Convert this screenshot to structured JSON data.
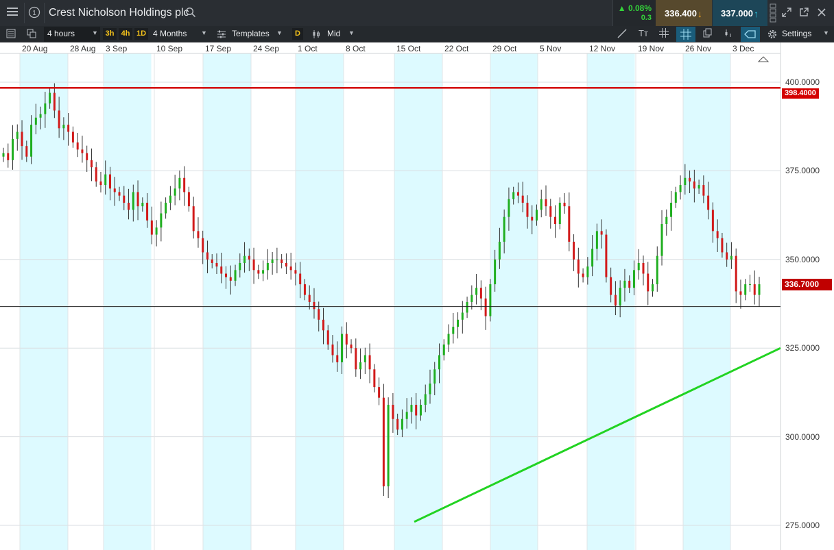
{
  "window": {
    "menu_icon": "hamburger-menu-icon",
    "info_icon": "info-circle-icon",
    "title": "Crest Nicholson Holdings plc",
    "search_icon": "search-icon"
  },
  "quote": {
    "change_pct": "▲ 0.08%",
    "change_abs": "0.3",
    "sell": "336.400",
    "buy": "337.000",
    "up_color": "#34d33a",
    "sell_bg": "#5a4a2b",
    "buy_bg": "#1e4a5a"
  },
  "toolbar": {
    "interval": "4 hours",
    "quick_intervals": [
      "3h",
      "4h",
      "1D"
    ],
    "range": "4 Months",
    "templates": "Templates",
    "drawing_mode": "D",
    "price_type": "Mid",
    "settings": "Settings"
  },
  "chart_data": {
    "type": "candlestick",
    "x_tick_labels": [
      "20 Aug",
      "28 Aug",
      "3 Sep",
      "10 Sep",
      "17 Sep",
      "24 Sep",
      "1 Oct",
      "8 Oct",
      "15 Oct",
      "22 Oct",
      "29 Oct",
      "5 Nov",
      "12 Nov",
      "19 Nov",
      "26 Nov",
      "3 Dec"
    ],
    "y_tick_labels": [
      "400.0000",
      "375.0000",
      "350.0000",
      "325.0000",
      "300.0000",
      "275.0000"
    ],
    "y_ticks": [
      400,
      375,
      350,
      325,
      300,
      275
    ],
    "ylim": [
      273,
      403.5
    ],
    "grid": true,
    "resistance_line": {
      "value": 398.4,
      "label": "398.4000",
      "color": "#d40000"
    },
    "current_price": {
      "value": 336.7,
      "label": "336.7000",
      "color": "#c00000"
    },
    "trend_line": {
      "color": "#22d322",
      "from": {
        "date": "15 Oct",
        "value": 276
      },
      "to": {
        "date": "5 Dec",
        "value": 325
      }
    },
    "up_color": "#1fae1f",
    "down_color": "#d11a1a",
    "closes": [
      380,
      378,
      384,
      386,
      382,
      379,
      388,
      390,
      391,
      394,
      397,
      392,
      387,
      388,
      386,
      383,
      381,
      380,
      378,
      376,
      372,
      371,
      374,
      370,
      369,
      368,
      366,
      364,
      369,
      365,
      366,
      361,
      357,
      359,
      363,
      366,
      368,
      370,
      373,
      369,
      365,
      358,
      356,
      352,
      350,
      349,
      348,
      346,
      345,
      344,
      347,
      349,
      351,
      350,
      347,
      346,
      347,
      349,
      350,
      350,
      349,
      348,
      347,
      346,
      343,
      340,
      338,
      336,
      333,
      330,
      326,
      323,
      321,
      329,
      326,
      325,
      319,
      321,
      323,
      319,
      314,
      311,
      286,
      309,
      305,
      302,
      305,
      307,
      309,
      306,
      309,
      312,
      315,
      319,
      323,
      326,
      329,
      331,
      333,
      335,
      338,
      340,
      342,
      339,
      334,
      343,
      350,
      355,
      362,
      367,
      369,
      368,
      366,
      362,
      361,
      364,
      367,
      365,
      362,
      360,
      366,
      365,
      355,
      350,
      346,
      345,
      348,
      353,
      358,
      357,
      345,
      340,
      337,
      342,
      344,
      342,
      347,
      349,
      346,
      341,
      343,
      351,
      360,
      362,
      366,
      369,
      371,
      373,
      372,
      370,
      371,
      368,
      364,
      358,
      356,
      352,
      350,
      351,
      341,
      340,
      343,
      343,
      340,
      343
    ]
  }
}
